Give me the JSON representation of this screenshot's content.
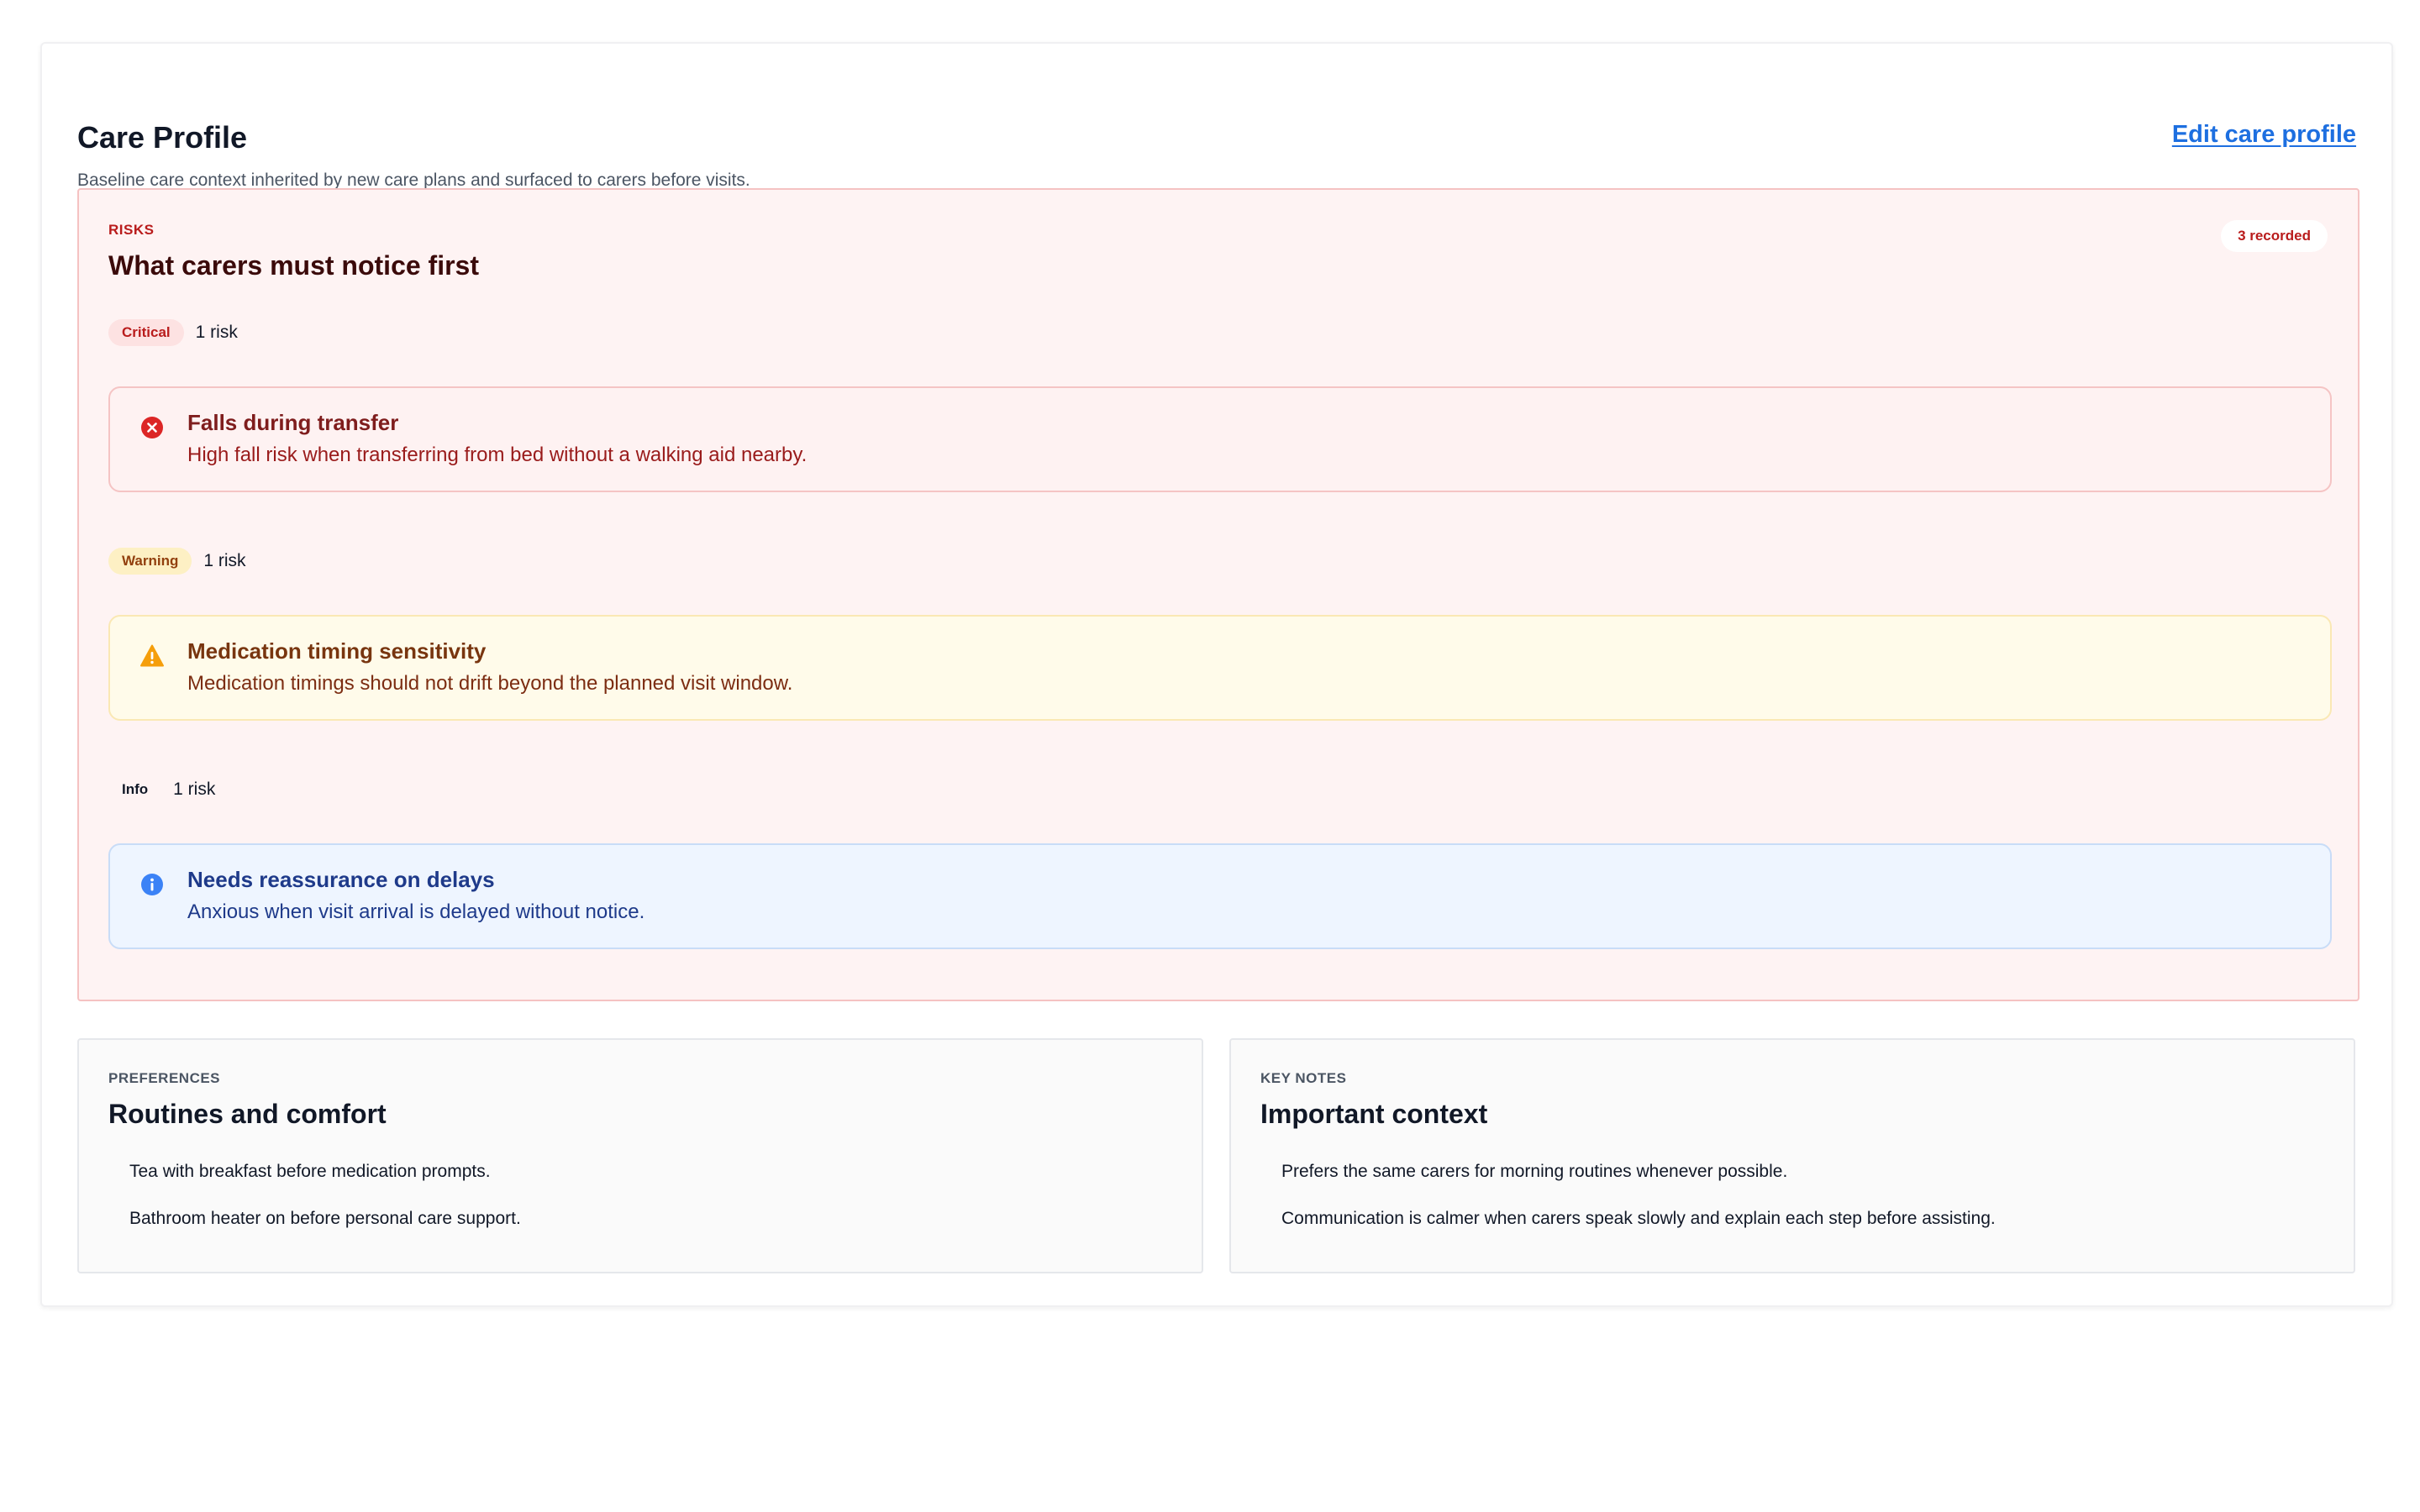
{
  "header": {
    "title": "Care Profile",
    "subtitle": "Baseline care context inherited by new care plans and surfaced to carers before visits.",
    "edit_link": "Edit care profile"
  },
  "risks": {
    "eyebrow": "RISKS",
    "title": "What carers must notice first",
    "count_label": "3 recorded",
    "groups": [
      {
        "severity": "Critical",
        "count": "1 risk",
        "icon": "error-circle-icon",
        "color": "#dc2626",
        "item": {
          "title": "Falls during transfer",
          "description": "High fall risk when transferring from bed without a walking aid nearby."
        }
      },
      {
        "severity": "Warning",
        "count": "1 risk",
        "icon": "warning-triangle-icon",
        "color": "#f59e0b",
        "item": {
          "title": "Medication timing sensitivity",
          "description": "Medication timings should not drift beyond the planned visit window."
        }
      },
      {
        "severity": "Info",
        "count": "1 risk",
        "icon": "info-circle-icon",
        "color": "#3b82f6",
        "item": {
          "title": "Needs reassurance on delays",
          "description": "Anxious when visit arrival is delayed without notice."
        }
      }
    ]
  },
  "preferences": {
    "eyebrow": "PREFERENCES",
    "title": "Routines and comfort",
    "items": [
      "Tea with breakfast before medication prompts.",
      "Bathroom heater on before personal care support."
    ]
  },
  "key_notes": {
    "eyebrow": "KEY NOTES",
    "title": "Important context",
    "items": [
      "Prefers the same carers for morning routines whenever possible.",
      "Communication is calmer when carers speak slowly and explain each step before assisting."
    ]
  }
}
